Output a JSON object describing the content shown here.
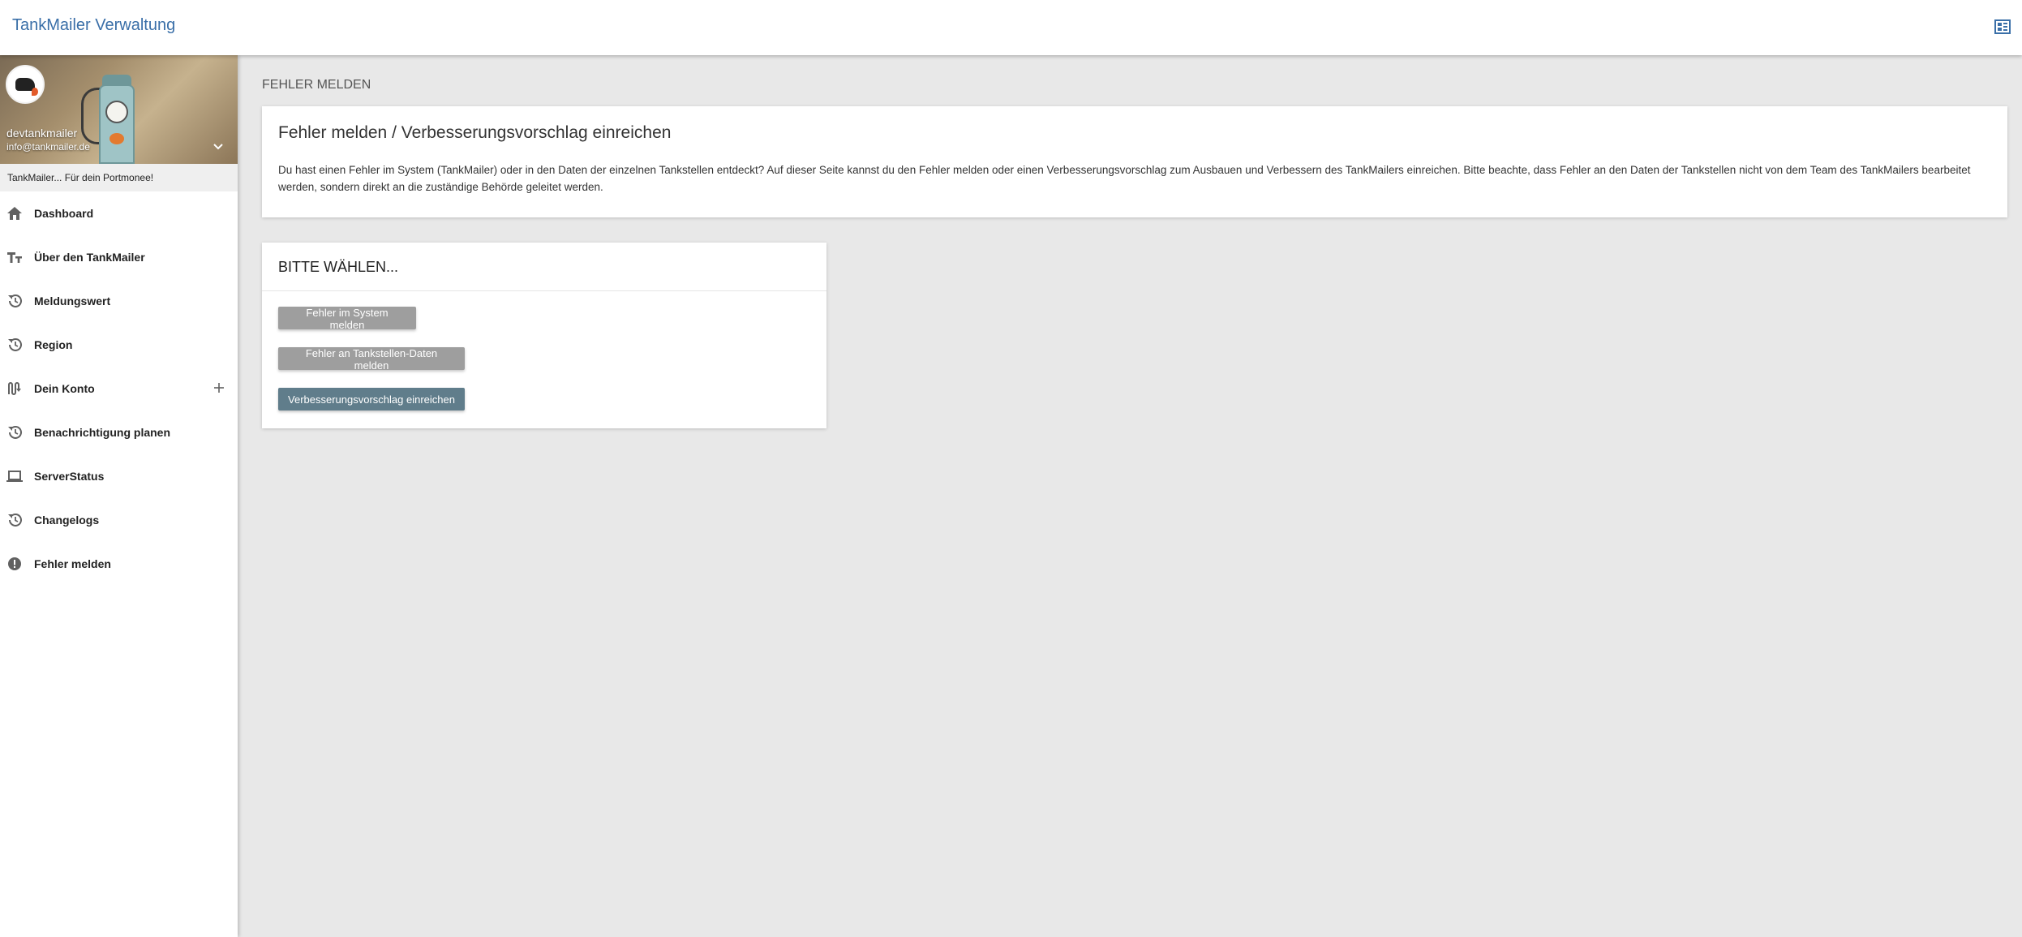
{
  "header": {
    "title": "TankMailer Verwaltung",
    "right_icon": "dashboard-layout-icon",
    "accent_color": "#3a6fa8"
  },
  "profile": {
    "name": "devtankmailer",
    "email": "info@tankmailer.de",
    "tagline": "TankMailer... Für dein Portmonee!"
  },
  "sidebar": {
    "items": [
      {
        "label": "Dashboard",
        "icon": "home-icon"
      },
      {
        "label": "Über den TankMailer",
        "icon": "text-format-icon"
      },
      {
        "label": "Meldungswert",
        "icon": "history-icon"
      },
      {
        "label": "Region",
        "icon": "history-icon"
      },
      {
        "label": "Dein Konto",
        "icon": "route-icon",
        "expandable": true
      },
      {
        "label": "Benachrichtigung planen",
        "icon": "history-icon"
      },
      {
        "label": "ServerStatus",
        "icon": "laptop-icon"
      },
      {
        "label": "Changelogs",
        "icon": "history-icon"
      },
      {
        "label": "Fehler melden",
        "icon": "alert-icon"
      }
    ]
  },
  "main": {
    "breadcrumb": "FEHLER MELDEN",
    "info_card": {
      "title": "Fehler melden / Verbesserungsvorschlag einreichen",
      "text": "Du hast einen Fehler im System (TankMailer) oder in den Daten der einzelnen Tankstellen entdeckt? Auf dieser Seite kannst du den Fehler melden oder einen Verbesserungsvorschlag zum Ausbauen und Verbessern des TankMailers einreichen. Bitte beachte, dass Fehler an den Daten der Tankstellen nicht von dem Team des TankMailers bearbeitet werden, sondern direkt an die zuständige Behörde geleitet werden."
    },
    "choice_card": {
      "title": "BITTE WÄHLEN...",
      "buttons": [
        {
          "label": "Fehler im System melden",
          "color": "#9e9e9e"
        },
        {
          "label": "Fehler an Tankstellen-Daten melden",
          "color": "#9e9e9e"
        },
        {
          "label": "Verbesserungsvorschlag einreichen",
          "color": "#607d8b"
        }
      ]
    }
  }
}
